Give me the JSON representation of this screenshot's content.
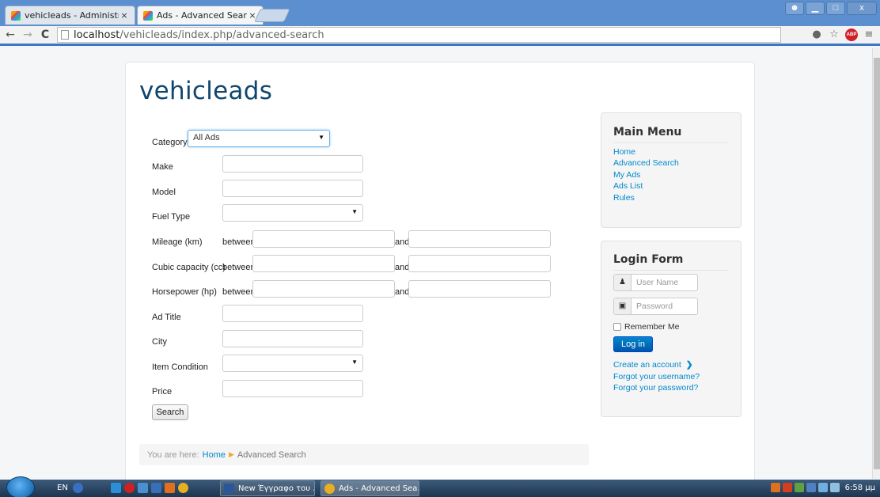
{
  "browser": {
    "tabs": [
      {
        "title": "vehicleads - Administratio",
        "close": "×"
      },
      {
        "title": "Ads - Advanced Search",
        "close": "×"
      }
    ],
    "url_host": "localhost",
    "url_path": "/vehicleads/index.php/advanced-search",
    "window_buttons": [
      "▁",
      "□",
      "x"
    ]
  },
  "site": {
    "brand": "vehicleads"
  },
  "search_form": {
    "category_label": "Category",
    "category_value": "All Ads",
    "make_label": "Make",
    "model_label": "Model",
    "fuel_type_label": "Fuel Type",
    "mileage_label": "Mileage (km)",
    "cubic_label": "Cubic capacity (cc)",
    "horsepower_label": "Horsepower (hp)",
    "between": "between",
    "and": "and",
    "ad_title_label": "Ad Title",
    "city_label": "City",
    "item_condition_label": "Item Condition",
    "price_label": "Price",
    "search_button": "Search"
  },
  "breadcrumb": {
    "prefix": "You are here:",
    "home": "Home",
    "current": "Advanced Search"
  },
  "main_menu": {
    "title": "Main Menu",
    "items": [
      "Home",
      "Advanced Search",
      "My Ads",
      "Ads List",
      "Rules"
    ]
  },
  "login_form": {
    "title": "Login Form",
    "username_placeholder": "User Name",
    "password_placeholder": "Password",
    "remember_label": "Remember Me",
    "login_button": "Log in",
    "create_account": "Create an account",
    "forgot_username": "Forgot your username?",
    "forgot_password": "Forgot your password?"
  },
  "taskbar": {
    "lang": "EN",
    "tasks": [
      "New Έγγραφο του ...",
      "Ads - Advanced Sea..."
    ],
    "clock": "6:58 μμ"
  },
  "colors": {
    "brand": "#10466e",
    "link": "#0088cc",
    "login_button": "#0066bb"
  }
}
